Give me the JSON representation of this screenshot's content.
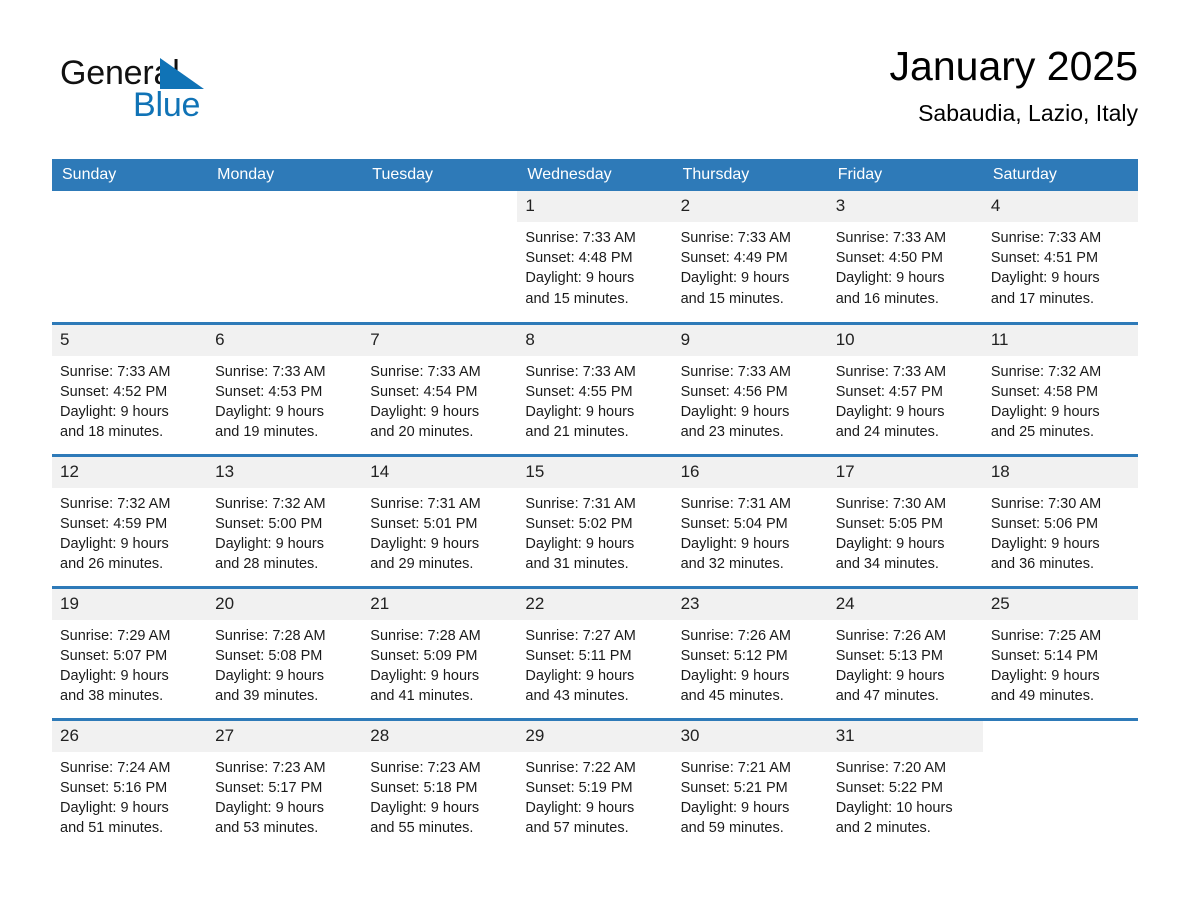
{
  "brand": {
    "name_part1": "General",
    "name_part2": "Blue",
    "accent_color": "#1073b6",
    "logo_icon": "triangle-icon"
  },
  "header": {
    "title": "January 2025",
    "location": "Sabaudia, Lazio, Italy"
  },
  "calendar": {
    "header_bg": "#2e7ab8",
    "row_divider_color": "#2e7ab8",
    "daynum_bg": "#f1f1f1",
    "weekdays": [
      "Sunday",
      "Monday",
      "Tuesday",
      "Wednesday",
      "Thursday",
      "Friday",
      "Saturday"
    ],
    "weeks": [
      [
        {
          "day": "",
          "lines": []
        },
        {
          "day": "",
          "lines": []
        },
        {
          "day": "",
          "lines": []
        },
        {
          "day": "1",
          "lines": [
            "Sunrise: 7:33 AM",
            "Sunset: 4:48 PM",
            "Daylight: 9 hours",
            "and 15 minutes."
          ]
        },
        {
          "day": "2",
          "lines": [
            "Sunrise: 7:33 AM",
            "Sunset: 4:49 PM",
            "Daylight: 9 hours",
            "and 15 minutes."
          ]
        },
        {
          "day": "3",
          "lines": [
            "Sunrise: 7:33 AM",
            "Sunset: 4:50 PM",
            "Daylight: 9 hours",
            "and 16 minutes."
          ]
        },
        {
          "day": "4",
          "lines": [
            "Sunrise: 7:33 AM",
            "Sunset: 4:51 PM",
            "Daylight: 9 hours",
            "and 17 minutes."
          ]
        }
      ],
      [
        {
          "day": "5",
          "lines": [
            "Sunrise: 7:33 AM",
            "Sunset: 4:52 PM",
            "Daylight: 9 hours",
            "and 18 minutes."
          ]
        },
        {
          "day": "6",
          "lines": [
            "Sunrise: 7:33 AM",
            "Sunset: 4:53 PM",
            "Daylight: 9 hours",
            "and 19 minutes."
          ]
        },
        {
          "day": "7",
          "lines": [
            "Sunrise: 7:33 AM",
            "Sunset: 4:54 PM",
            "Daylight: 9 hours",
            "and 20 minutes."
          ]
        },
        {
          "day": "8",
          "lines": [
            "Sunrise: 7:33 AM",
            "Sunset: 4:55 PM",
            "Daylight: 9 hours",
            "and 21 minutes."
          ]
        },
        {
          "day": "9",
          "lines": [
            "Sunrise: 7:33 AM",
            "Sunset: 4:56 PM",
            "Daylight: 9 hours",
            "and 23 minutes."
          ]
        },
        {
          "day": "10",
          "lines": [
            "Sunrise: 7:33 AM",
            "Sunset: 4:57 PM",
            "Daylight: 9 hours",
            "and 24 minutes."
          ]
        },
        {
          "day": "11",
          "lines": [
            "Sunrise: 7:32 AM",
            "Sunset: 4:58 PM",
            "Daylight: 9 hours",
            "and 25 minutes."
          ]
        }
      ],
      [
        {
          "day": "12",
          "lines": [
            "Sunrise: 7:32 AM",
            "Sunset: 4:59 PM",
            "Daylight: 9 hours",
            "and 26 minutes."
          ]
        },
        {
          "day": "13",
          "lines": [
            "Sunrise: 7:32 AM",
            "Sunset: 5:00 PM",
            "Daylight: 9 hours",
            "and 28 minutes."
          ]
        },
        {
          "day": "14",
          "lines": [
            "Sunrise: 7:31 AM",
            "Sunset: 5:01 PM",
            "Daylight: 9 hours",
            "and 29 minutes."
          ]
        },
        {
          "day": "15",
          "lines": [
            "Sunrise: 7:31 AM",
            "Sunset: 5:02 PM",
            "Daylight: 9 hours",
            "and 31 minutes."
          ]
        },
        {
          "day": "16",
          "lines": [
            "Sunrise: 7:31 AM",
            "Sunset: 5:04 PM",
            "Daylight: 9 hours",
            "and 32 minutes."
          ]
        },
        {
          "day": "17",
          "lines": [
            "Sunrise: 7:30 AM",
            "Sunset: 5:05 PM",
            "Daylight: 9 hours",
            "and 34 minutes."
          ]
        },
        {
          "day": "18",
          "lines": [
            "Sunrise: 7:30 AM",
            "Sunset: 5:06 PM",
            "Daylight: 9 hours",
            "and 36 minutes."
          ]
        }
      ],
      [
        {
          "day": "19",
          "lines": [
            "Sunrise: 7:29 AM",
            "Sunset: 5:07 PM",
            "Daylight: 9 hours",
            "and 38 minutes."
          ]
        },
        {
          "day": "20",
          "lines": [
            "Sunrise: 7:28 AM",
            "Sunset: 5:08 PM",
            "Daylight: 9 hours",
            "and 39 minutes."
          ]
        },
        {
          "day": "21",
          "lines": [
            "Sunrise: 7:28 AM",
            "Sunset: 5:09 PM",
            "Daylight: 9 hours",
            "and 41 minutes."
          ]
        },
        {
          "day": "22",
          "lines": [
            "Sunrise: 7:27 AM",
            "Sunset: 5:11 PM",
            "Daylight: 9 hours",
            "and 43 minutes."
          ]
        },
        {
          "day": "23",
          "lines": [
            "Sunrise: 7:26 AM",
            "Sunset: 5:12 PM",
            "Daylight: 9 hours",
            "and 45 minutes."
          ]
        },
        {
          "day": "24",
          "lines": [
            "Sunrise: 7:26 AM",
            "Sunset: 5:13 PM",
            "Daylight: 9 hours",
            "and 47 minutes."
          ]
        },
        {
          "day": "25",
          "lines": [
            "Sunrise: 7:25 AM",
            "Sunset: 5:14 PM",
            "Daylight: 9 hours",
            "and 49 minutes."
          ]
        }
      ],
      [
        {
          "day": "26",
          "lines": [
            "Sunrise: 7:24 AM",
            "Sunset: 5:16 PM",
            "Daylight: 9 hours",
            "and 51 minutes."
          ]
        },
        {
          "day": "27",
          "lines": [
            "Sunrise: 7:23 AM",
            "Sunset: 5:17 PM",
            "Daylight: 9 hours",
            "and 53 minutes."
          ]
        },
        {
          "day": "28",
          "lines": [
            "Sunrise: 7:23 AM",
            "Sunset: 5:18 PM",
            "Daylight: 9 hours",
            "and 55 minutes."
          ]
        },
        {
          "day": "29",
          "lines": [
            "Sunrise: 7:22 AM",
            "Sunset: 5:19 PM",
            "Daylight: 9 hours",
            "and 57 minutes."
          ]
        },
        {
          "day": "30",
          "lines": [
            "Sunrise: 7:21 AM",
            "Sunset: 5:21 PM",
            "Daylight: 9 hours",
            "and 59 minutes."
          ]
        },
        {
          "day": "31",
          "lines": [
            "Sunrise: 7:20 AM",
            "Sunset: 5:22 PM",
            "Daylight: 10 hours",
            "and 2 minutes."
          ]
        },
        {
          "day": "",
          "lines": []
        }
      ]
    ]
  }
}
